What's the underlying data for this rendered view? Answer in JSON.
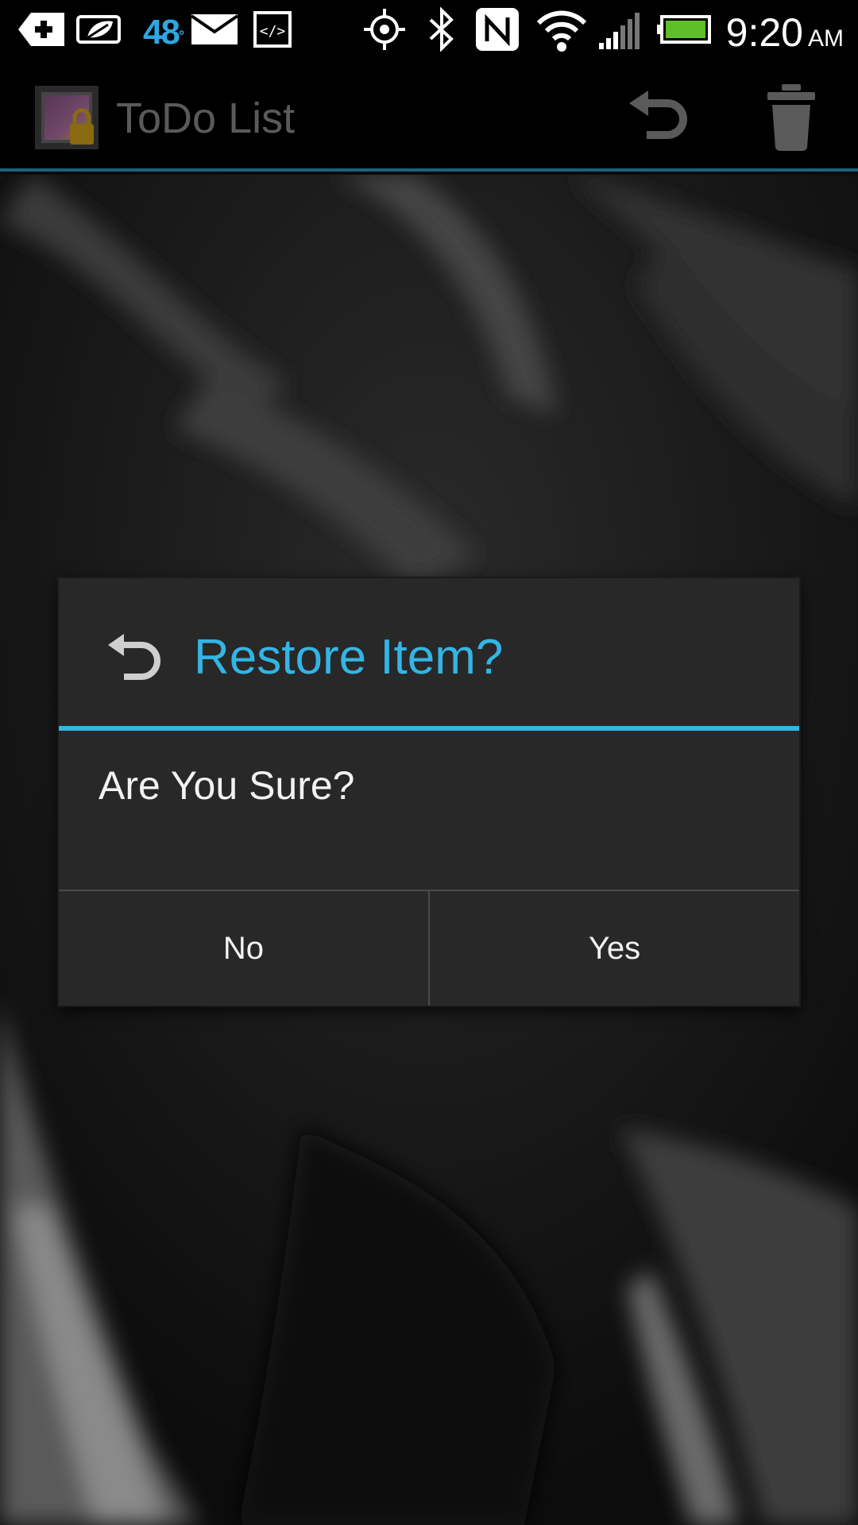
{
  "status_bar": {
    "icons": [
      "plus-notification-icon",
      "leaf-icon",
      "gmail-icon",
      "code-icon",
      "gps-icon",
      "bluetooth-icon",
      "nfc-icon",
      "wifi-icon",
      "signal-icon",
      "battery-icon"
    ],
    "temperature": "48",
    "temperature_unit": "°",
    "time": "9:20",
    "ampm": "AM",
    "battery_color": "#5fbf2a"
  },
  "action_bar": {
    "title": "ToDo List",
    "actions": [
      "undo-icon",
      "trash-icon"
    ]
  },
  "dialog": {
    "title": "Restore Item?",
    "message": "Are You Sure?",
    "buttons": {
      "no": "No",
      "yes": "Yes"
    }
  },
  "colors": {
    "accent": "#33b5e5",
    "dialog_bg": "#282828",
    "action_bar_divider": "#1f5f7a"
  }
}
